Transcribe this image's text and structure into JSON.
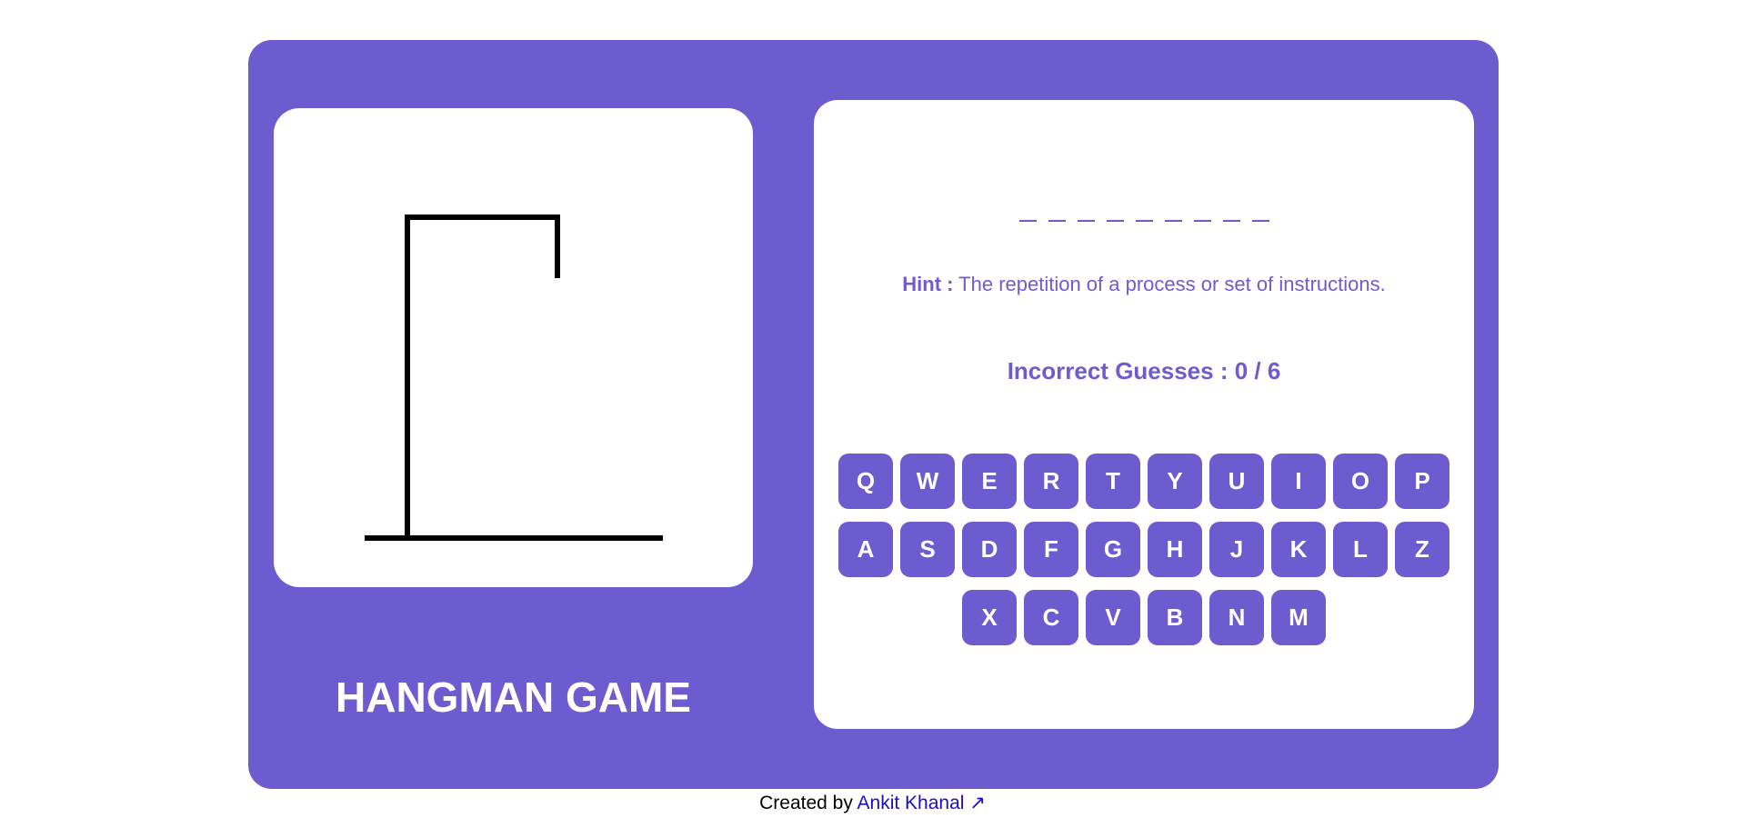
{
  "title": "HANGMAN GAME",
  "word": {
    "slots": [
      "",
      "",
      "",
      "",
      "",
      "",
      "",
      "",
      ""
    ]
  },
  "hint": {
    "label": "Hint :",
    "text": "The repetition of a process or set of instructions."
  },
  "incorrect_guesses": {
    "text": "Incorrect Guesses : 0 / 6",
    "count": 0,
    "max": 6
  },
  "keyboard": {
    "rows": [
      [
        "Q",
        "W",
        "E",
        "R",
        "T",
        "Y",
        "U",
        "I",
        "O",
        "P"
      ],
      [
        "A",
        "S",
        "D",
        "F",
        "G",
        "H",
        "J",
        "K",
        "L",
        "Z"
      ],
      [
        "X",
        "C",
        "V",
        "B",
        "N",
        "M"
      ]
    ]
  },
  "footer": {
    "prefix": "Created by",
    "author_link": "Ankit Khanal ↗"
  },
  "colors": {
    "accent": "#6c5ccf",
    "card": "#ffffff",
    "link": "#1a0dcc"
  }
}
